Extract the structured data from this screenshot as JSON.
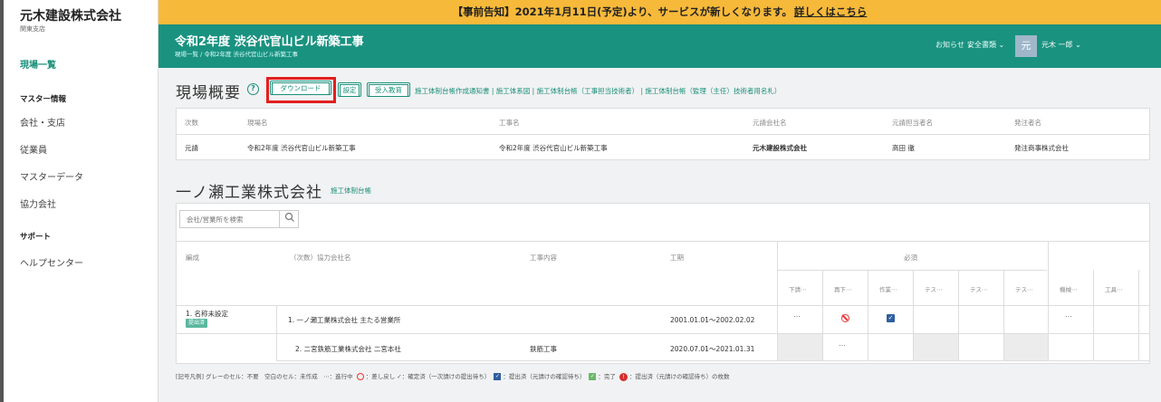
{
  "sidebar": {
    "company": "元木建設株式会社",
    "branch": "関東支店",
    "items": [
      {
        "label": "現場一覧"
      },
      {
        "label": "マスター情報"
      },
      {
        "label": "会社・支店"
      },
      {
        "label": "従業員"
      },
      {
        "label": "マスターデータ"
      },
      {
        "label": "協力会社"
      },
      {
        "label": "サポート"
      },
      {
        "label": "ヘルプセンター"
      }
    ]
  },
  "notice": {
    "text": "【事前告知】2021年1月11日(予定)より、サービスが新しくなります。",
    "link": "詳しくはこちら"
  },
  "header": {
    "title": "令和2年度 渋谷代官山ビル新築工事",
    "breadcrumb": "現場一覧 / 令和2年度 渋谷代官山ビル新築工事",
    "notifications": "お知らせ ⌄",
    "safety_docs": "安全書類 ⌄",
    "avatar": "元",
    "user": "元木 一郎 ⌄",
    "colors": {
      "header": "#1a9280",
      "notice": "#f7b93a",
      "accent": "#1a8f7a",
      "highlight": "#e11f1f"
    }
  },
  "overview": {
    "title": "現場概要",
    "help": "?",
    "buttons": {
      "download": "ダウンロード",
      "settings": "設定",
      "education": "受入教育"
    },
    "links": "施工体制台帳作成通知書 | 施工体系図 | 施工体制台帳（工事担当技術者） | 施工体制台帳（監理（主任）技術者用名札）",
    "columns": [
      "次数",
      "現場名",
      "工事名",
      "元請会社名",
      "元請担当者名",
      "発注者名"
    ],
    "row": [
      "元請",
      "令和2年度 渋谷代官山ビル新築工事",
      "令和2年度 渋谷代官山ビル新築工事",
      "元木建設株式会社",
      "高田 徹",
      "発注商事株式会社"
    ]
  },
  "section": {
    "title": "一ノ瀬工業株式会社",
    "link": "施工体制台帳",
    "search_placeholder": "会社/営業所を検索",
    "search_icon": "search-icon",
    "columns": [
      "編成",
      "（次数）協力会社名",
      "工事内容",
      "工期"
    ],
    "required_label": "必須",
    "sub_columns": [
      "下請⋯",
      "再下⋯",
      "作業⋯",
      "テス⋯",
      "テス⋯",
      "テス⋯",
      "機械⋯",
      "工具⋯"
    ],
    "rows": [
      {
        "group": "1. 名称未設定",
        "badge": "提出済",
        "company": "1. 一ノ瀬工業株式会社 主たる営業所",
        "work": "",
        "period": "2001.01.01～2002.02.02"
      },
      {
        "group": "",
        "badge": "",
        "company": "2. 二宮鉄筋工業株式会社 二宮本社",
        "work": "鉄筋工事",
        "period": "2020.07.01～2021.01.31"
      }
    ],
    "status_dots": "⋯"
  },
  "legend": {
    "prefix": "[記号凡例] グレーのセル：不要　空白のセル：未作成　⋯：進行中",
    "reject": "：差し戻し",
    "confirmed": "：確定済（一次請けの提出待ち）",
    "submitted": "：提出済（元請けの確認待ち）",
    "done": "：完了",
    "count": "：提出済（元請けの確認待ち）の枚数"
  }
}
